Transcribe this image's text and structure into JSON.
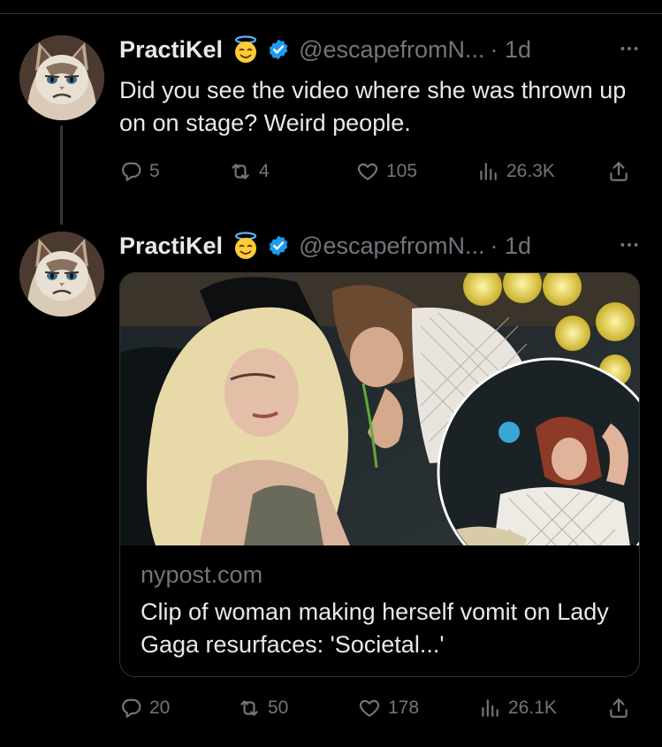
{
  "tweets": [
    {
      "author": {
        "name": "PractiKel",
        "handle": "@escapefromN...",
        "time": "· 1d",
        "avatar": "grumpy-cat-avatar"
      },
      "text": "Did you see the video where she was thrown up on on stage? Weird people.",
      "stats": {
        "replies": "5",
        "retweets": "4",
        "likes": "105",
        "views": "26.3K"
      }
    },
    {
      "author": {
        "name": "PractiKel",
        "handle": "@escapefromN...",
        "time": "· 1d",
        "avatar": "grumpy-cat-avatar"
      },
      "card": {
        "domain": "nypost.com",
        "title": "Clip of woman making herself vomit on Lady Gaga resurfaces: 'Societal...'"
      },
      "stats": {
        "replies": "20",
        "retweets": "50",
        "likes": "178",
        "views": "26.1K"
      }
    }
  ],
  "icons": {
    "reply": "reply-icon",
    "retweet": "retweet-icon",
    "like": "heart-icon",
    "views": "views-icon",
    "share": "share-icon",
    "more": "more-icon",
    "verified": "verified-badge-icon",
    "emoji": "angel-emoji-icon"
  },
  "colors": {
    "background": "#000000",
    "text": "#e7e9ea",
    "muted": "#71767b",
    "verified": "#1d9bf0",
    "divider": "#2f3336"
  }
}
